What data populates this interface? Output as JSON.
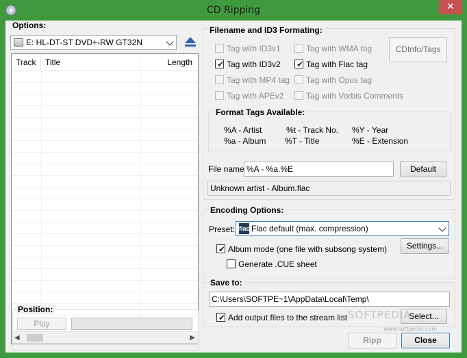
{
  "window": {
    "title": "CD Ripping",
    "close_glyph": "✕"
  },
  "options": {
    "label": "Options:",
    "drive": "E: HL-DT-ST DVD+-RW GT32N",
    "eject_icon": "eject-icon"
  },
  "tracklist": {
    "columns": [
      "Track",
      "Title",
      "Length"
    ],
    "rows": []
  },
  "position": {
    "label": "Position:",
    "play_label": "Play"
  },
  "id3": {
    "label": "Filename and ID3 Formating:",
    "checkboxes": [
      {
        "label": "Tag with ID3v1",
        "checked": false,
        "enabled": false
      },
      {
        "label": "Tag with WMA tag",
        "checked": false,
        "enabled": false
      },
      {
        "label": "Tag with ID3v2",
        "checked": true,
        "enabled": true
      },
      {
        "label": "Tag with Flac tag",
        "checked": true,
        "enabled": true
      },
      {
        "label": "Tag with MP4 tag",
        "checked": false,
        "enabled": false
      },
      {
        "label": "Tag with Opus tag",
        "checked": false,
        "enabled": false
      },
      {
        "label": "Tag with APEv2",
        "checked": false,
        "enabled": false
      },
      {
        "label": "Tag with Vorbis Comments",
        "checked": false,
        "enabled": false
      }
    ],
    "cdinfo_label": "CDInfo/Tags",
    "format_tags": {
      "label": "Format Tags Available:",
      "items": [
        "%A - Artist",
        "%t - Track No.",
        "%Y - Year",
        "%a - Album",
        "%T - Title",
        "%E - Extension"
      ]
    },
    "filename_label": "File name:",
    "filename_value": "%A - %a.%E",
    "default_label": "Default",
    "preview": "Unknown artist - Album.flac"
  },
  "encoding": {
    "label": "Encoding Options:",
    "preset_label": "Preset:",
    "preset_value": "Flac default (max. compression)",
    "preset_icon_text": "flac",
    "settings_label": "Settings...",
    "album_mode_label": "Album mode (one file with subsong system)",
    "album_mode_checked": true,
    "cue_label": "Generate .CUE sheet",
    "cue_checked": false
  },
  "save": {
    "label": "Save to:",
    "path": "C:\\Users\\SOFTPE~1\\AppData\\Local\\Temp\\",
    "add_label": "Add output files to the stream list",
    "add_checked": true,
    "select_label": "Select..."
  },
  "footer": {
    "ripp_label": "Ripp",
    "close_label": "Close"
  },
  "watermark": "SOFTPEDIA",
  "watermark_small": "www.softpedia.com",
  "colors": {
    "titlebar": "#3f9a3f",
    "close": "#c75050"
  }
}
